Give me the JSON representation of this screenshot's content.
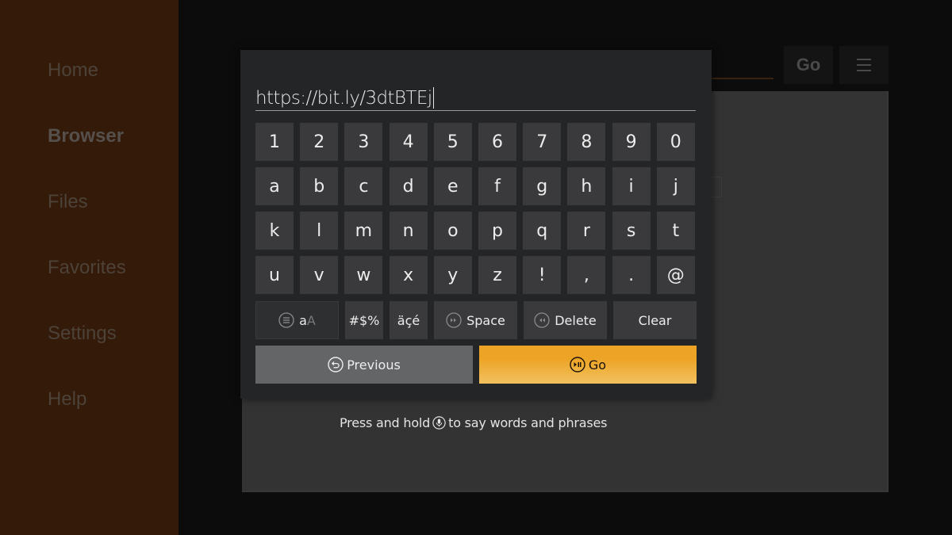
{
  "sidebar": {
    "items": [
      {
        "label": "Home",
        "active": false
      },
      {
        "label": "Browser",
        "active": true
      },
      {
        "label": "Files",
        "active": false
      },
      {
        "label": "Favorites",
        "active": false
      },
      {
        "label": "Settings",
        "active": false
      },
      {
        "label": "Help",
        "active": false
      }
    ]
  },
  "browser": {
    "go_label": "Go",
    "menu_icon": "hamburger-menu-icon",
    "accent_color": "#eda426"
  },
  "keyboard": {
    "input_value": "https://bit.ly/3dtBTEj",
    "rows": [
      [
        "1",
        "2",
        "3",
        "4",
        "5",
        "6",
        "7",
        "8",
        "9",
        "0"
      ],
      [
        "a",
        "b",
        "c",
        "d",
        "e",
        "f",
        "g",
        "h",
        "i",
        "j"
      ],
      [
        "k",
        "l",
        "m",
        "n",
        "o",
        "p",
        "q",
        "r",
        "s",
        "t"
      ],
      [
        "u",
        "v",
        "w",
        "x",
        "y",
        "z",
        "!",
        ",",
        ".",
        "@"
      ]
    ],
    "function_keys": {
      "shift_lower": "a",
      "shift_upper": "A",
      "shift_icon": "menu-circle-icon",
      "symbols": "#$%",
      "accents": "äçé",
      "space": "Space",
      "space_icon": "fast-forward-circle-icon",
      "delete": "Delete",
      "delete_icon": "rewind-circle-icon",
      "clear": "Clear"
    },
    "previous_label": "Previous",
    "previous_icon": "back-circle-icon",
    "go_label": "Go",
    "go_icon": "play-pause-circle-icon"
  },
  "voice_hint": {
    "before": "Press and hold",
    "after": "to say words and phrases",
    "icon": "microphone-icon"
  }
}
